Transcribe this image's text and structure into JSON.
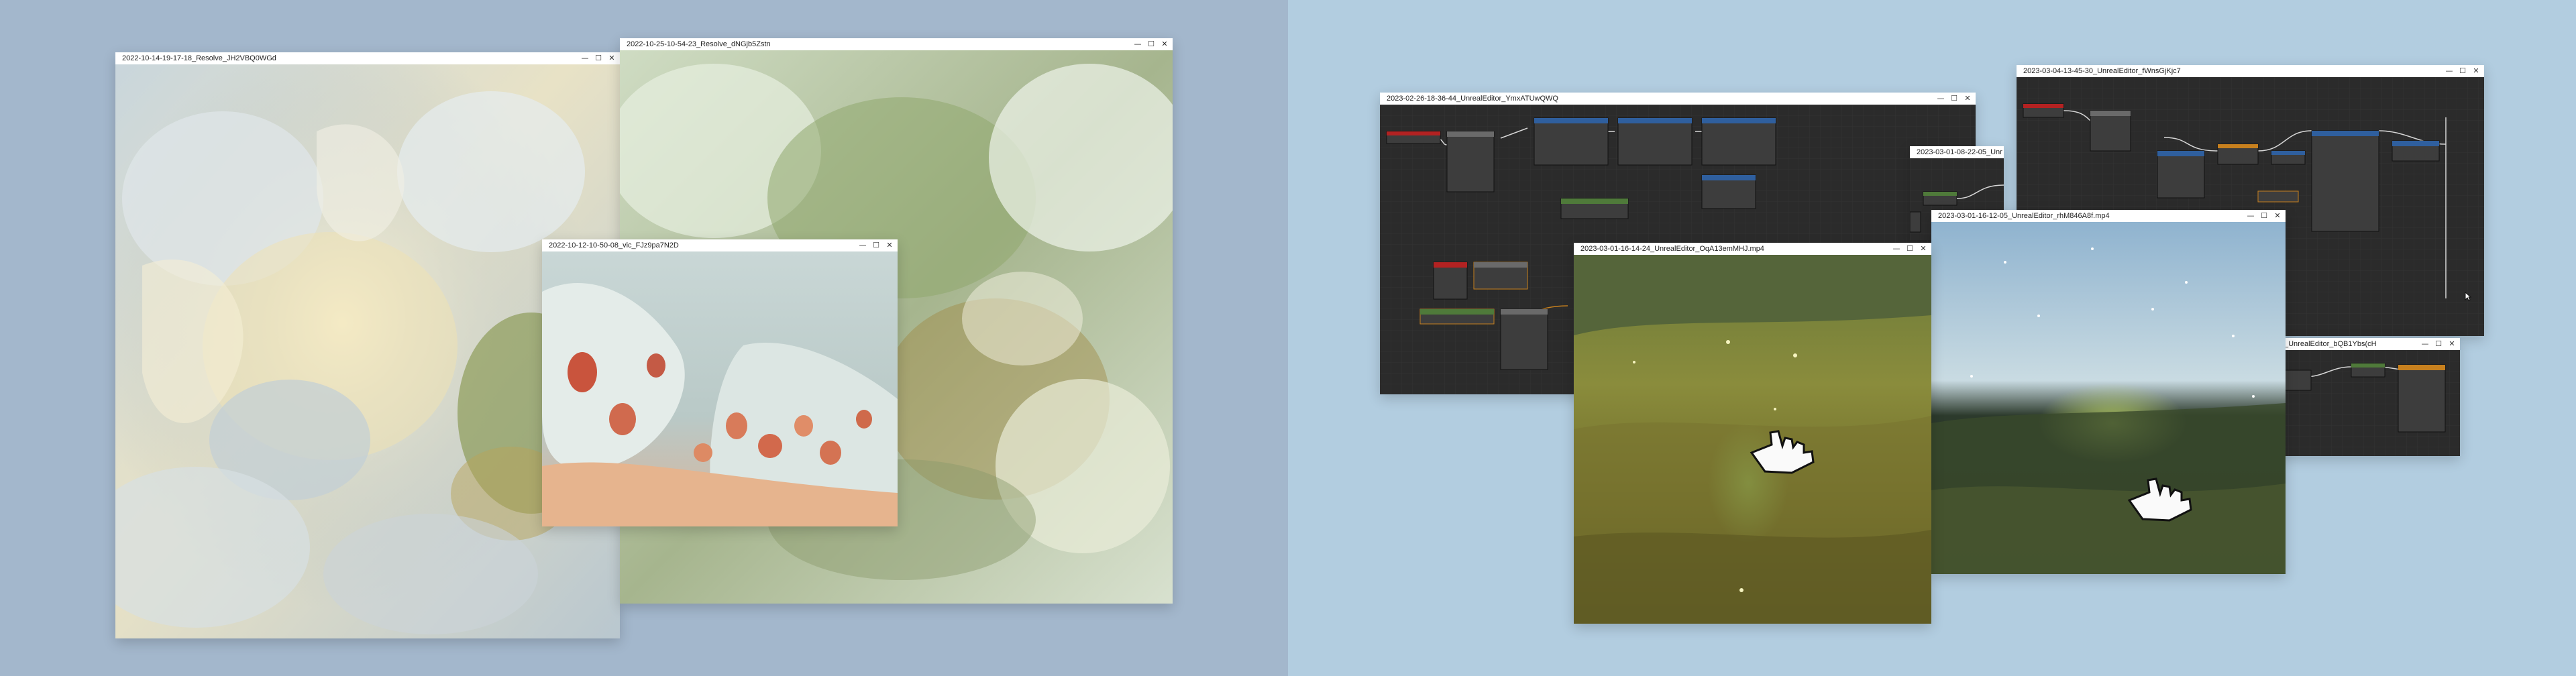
{
  "panels": {
    "left_bg": "#a3b7cc",
    "right_bg": "#b2cde0"
  },
  "windows": [
    {
      "id": "w1",
      "title": "2022-10-14-19-17-18_Resolve_JH2VBQ0WGd"
    },
    {
      "id": "w2",
      "title": "2022-10-25-10-54-23_Resolve_dNGjb5Zstn"
    },
    {
      "id": "w3",
      "title": "2022-10-12-10-50-08_vic_FJz9pa7N2D"
    },
    {
      "id": "w4",
      "title": "2023-02-26-18-36-44_UnrealEditor_YmxATUwQWQ"
    },
    {
      "id": "w5",
      "title": "2023-03-04-13-45-30_UnrealEditor_fWnsGjKjc7"
    },
    {
      "id": "w6",
      "title": "2023-03-01-08-22-05_Unr"
    },
    {
      "id": "w7",
      "title": "2023-03-01-16-12-05_UnrealEditor_rhM846A8f.mp4"
    },
    {
      "id": "w8",
      "title": "2023-03-01-16-14-24_UnrealEditor_OqA13emMHJ.mp4"
    },
    {
      "id": "w9",
      "title": "_UnrealEditor_bQB1Ybs(cH"
    }
  ],
  "controls": {
    "minimize": "—",
    "maximize": "☐",
    "close": "✕"
  },
  "colors": {
    "graph_bg": "#2b2b2b",
    "node_red": "#b32222",
    "node_blue": "#2f5f9e",
    "node_green": "#4f7a3a",
    "node_orange": "#c7801e",
    "node_gray": "#6a6a6a",
    "wire_white": "#d6d6d6"
  },
  "icons": [
    "minimize-icon",
    "maximize-icon",
    "close-icon",
    "hand-cursor-icon",
    "arrow-cursor-icon"
  ]
}
